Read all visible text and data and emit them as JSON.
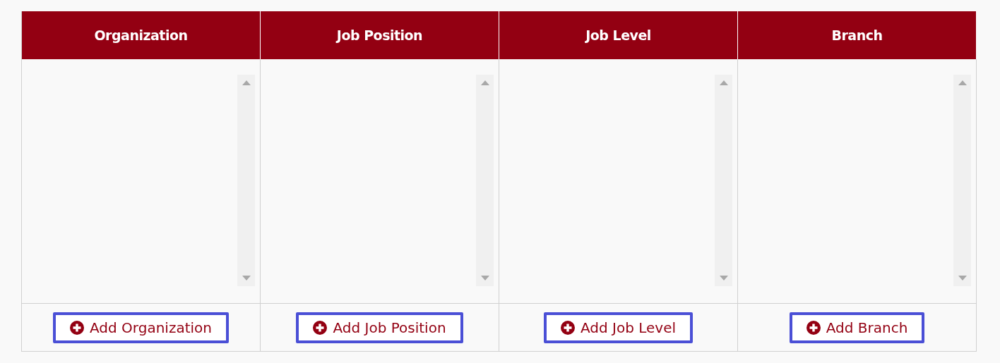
{
  "columns": [
    {
      "header": "Organization",
      "button": "Add Organization"
    },
    {
      "header": "Job Position",
      "button": "Add Job Position"
    },
    {
      "header": "Job Level",
      "button": "Add Job Level"
    },
    {
      "header": "Branch",
      "button": "Add Branch"
    }
  ]
}
